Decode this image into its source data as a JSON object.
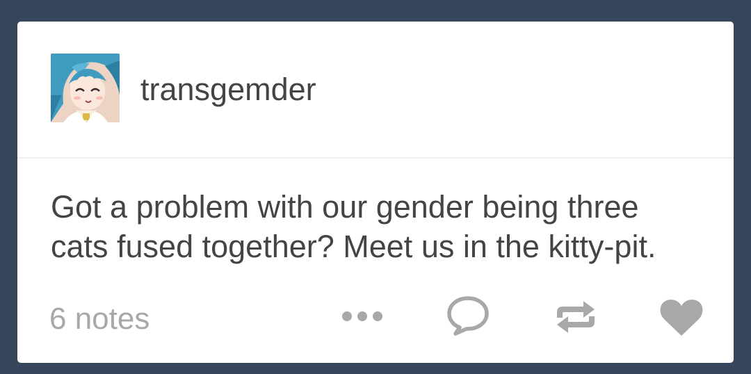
{
  "post": {
    "username": "transgemder",
    "avatar_icon": "avatar-image",
    "body_lines": [
      "Got a problem with our gender being three",
      "cats fused together? Meet us in the kitty-pit."
    ],
    "notes_label": "6 notes"
  },
  "actions": {
    "more_icon": "ellipsis-icon",
    "reply_icon": "speech-bubble-icon",
    "reblog_icon": "reblog-icon",
    "like_icon": "heart-icon"
  },
  "colors": {
    "background": "#36465d",
    "card": "#ffffff",
    "text": "#444444",
    "muted": "#a8a8a8"
  }
}
